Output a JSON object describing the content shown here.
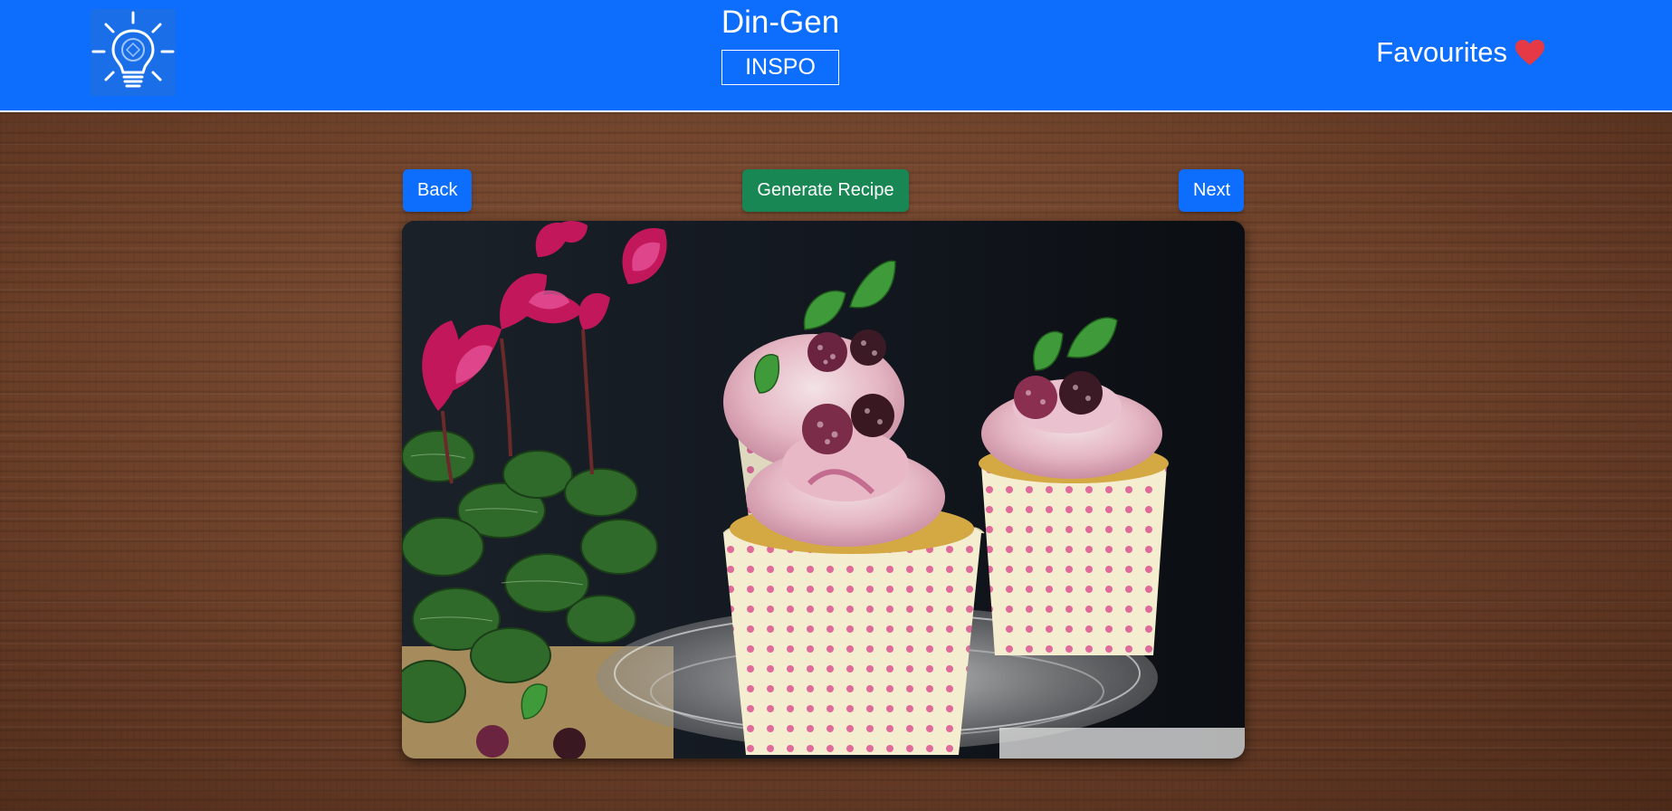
{
  "header": {
    "logo_icon": "lightbulb-icon",
    "title": "Din-Gen",
    "subtitle": "INSPO",
    "favourites_label": "Favourites",
    "favourites_icon": "heart-icon",
    "background_color": "#0d6efd",
    "heart_color": "#e63946"
  },
  "controls": {
    "back_label": "Back",
    "generate_label": "Generate Recipe",
    "next_label": "Next",
    "primary_color": "#0d6efd",
    "success_color": "#198754"
  },
  "main": {
    "image_icon": "cupcakes-photo"
  }
}
